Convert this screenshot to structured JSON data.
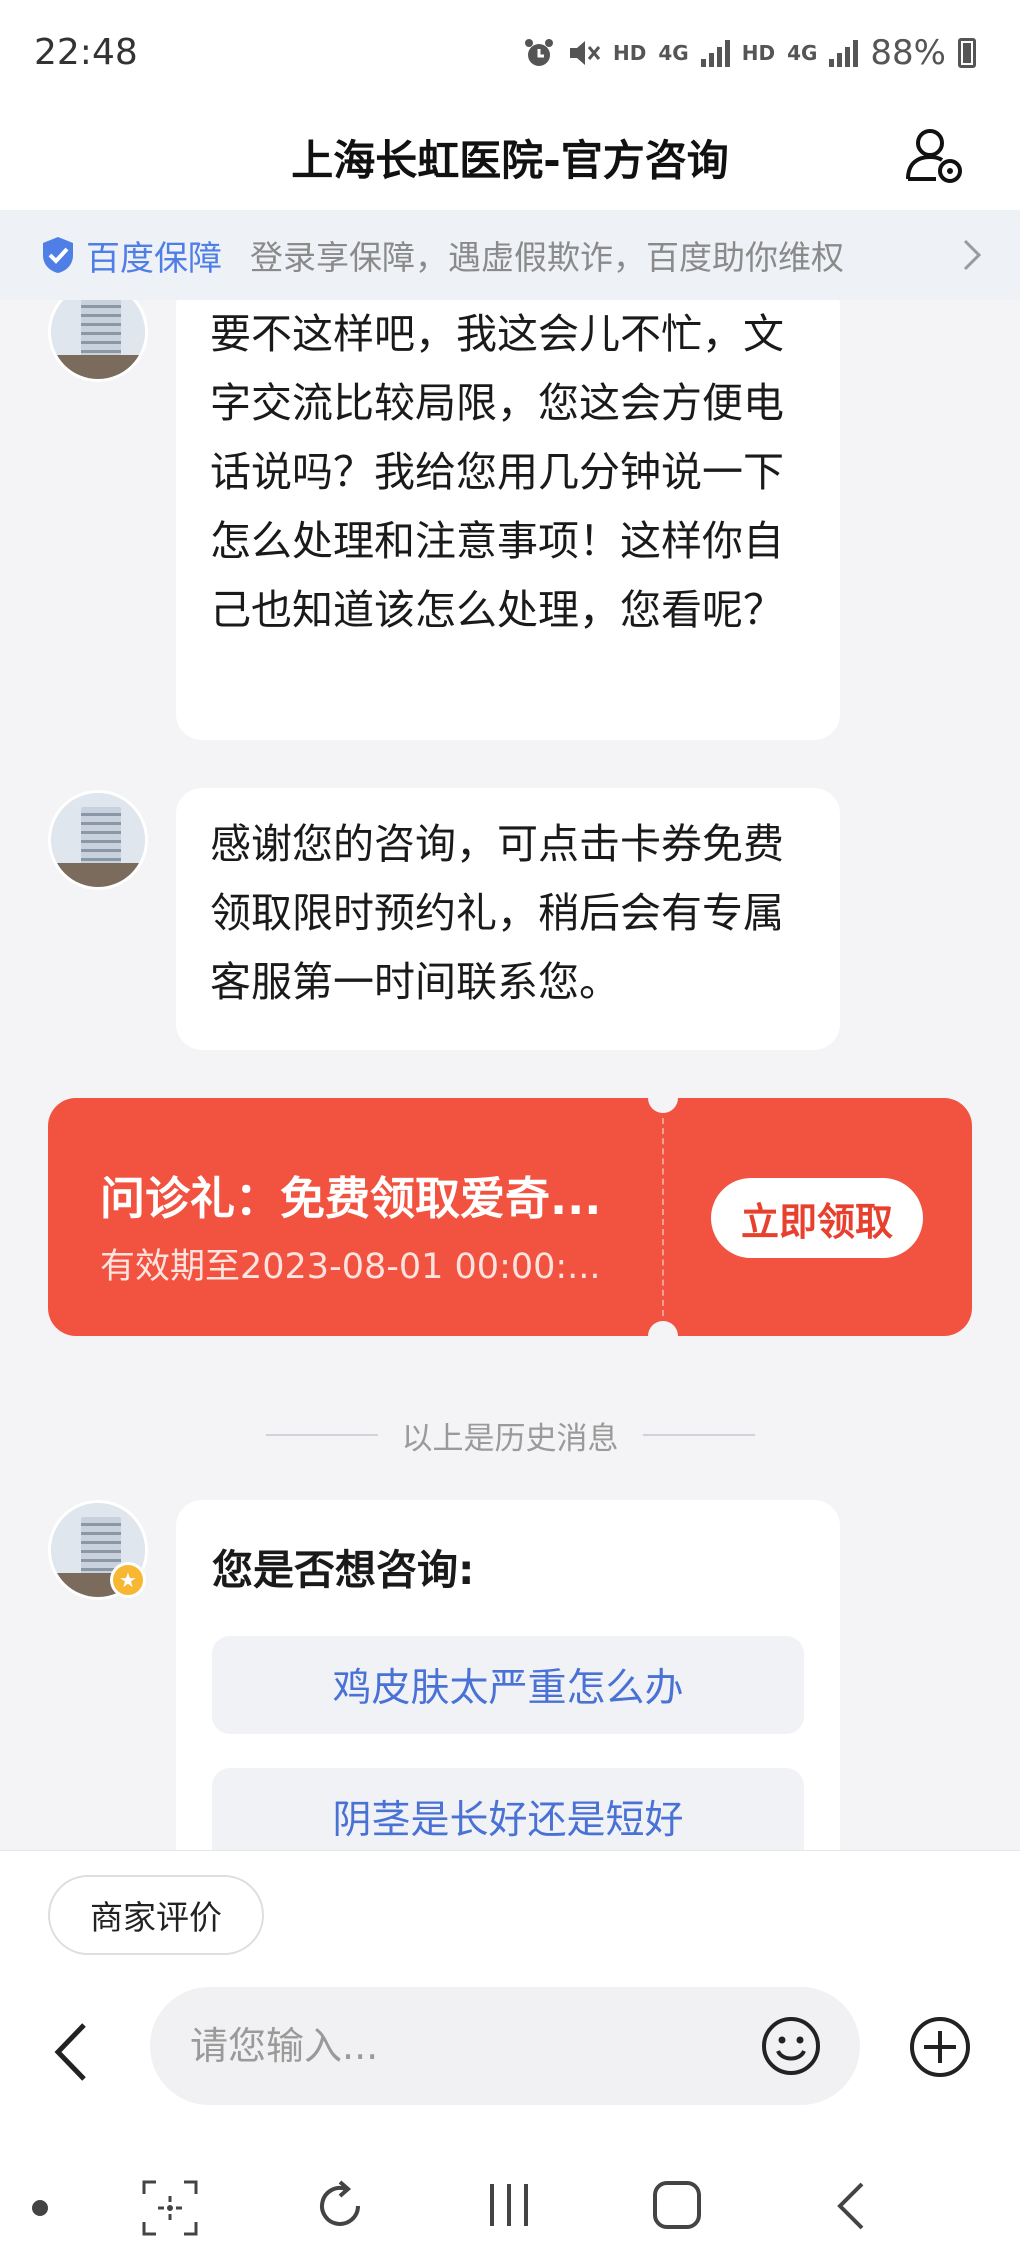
{
  "status_bar": {
    "time": "22:48",
    "hd1": "HD",
    "net1": "4G",
    "hd2": "HD",
    "net2": "4G",
    "battery": "88%"
  },
  "header": {
    "title": "上海长虹医院-官方咨询",
    "icon": "user-settings-icon"
  },
  "banner": {
    "brand": "百度保障",
    "text": "登录享保障，遇虚假欺诈，百度助你维权",
    "brand_color": "#4e7ee6"
  },
  "messages": [
    {
      "text": "要不这样吧，我这会儿不忙，文字交流比较局限，您这会方便电话说吗？我给您用几分钟说一下怎么处理和注意事项！这样你自己也知道该怎么处理，您看呢？"
    },
    {
      "text": "感谢您的咨询，可点击卡券免费领取限时预约礼，稍后会有专属客服第一时间联系您。"
    }
  ],
  "coupon": {
    "title": "问诊礼：免费领取爱奇...",
    "validity": "有效期至2023-08-01 00:00:...",
    "button": "立即领取",
    "color": "#f25240"
  },
  "history_divider": "以上是历史消息",
  "suggestions": {
    "title": "您是否想咨询:",
    "items": [
      {
        "label": "鸡皮肤太严重怎么办"
      },
      {
        "label": "阴茎是长好还是短好"
      }
    ]
  },
  "bottom": {
    "review_chip": "商家评价",
    "input_placeholder": "请您输入..."
  }
}
